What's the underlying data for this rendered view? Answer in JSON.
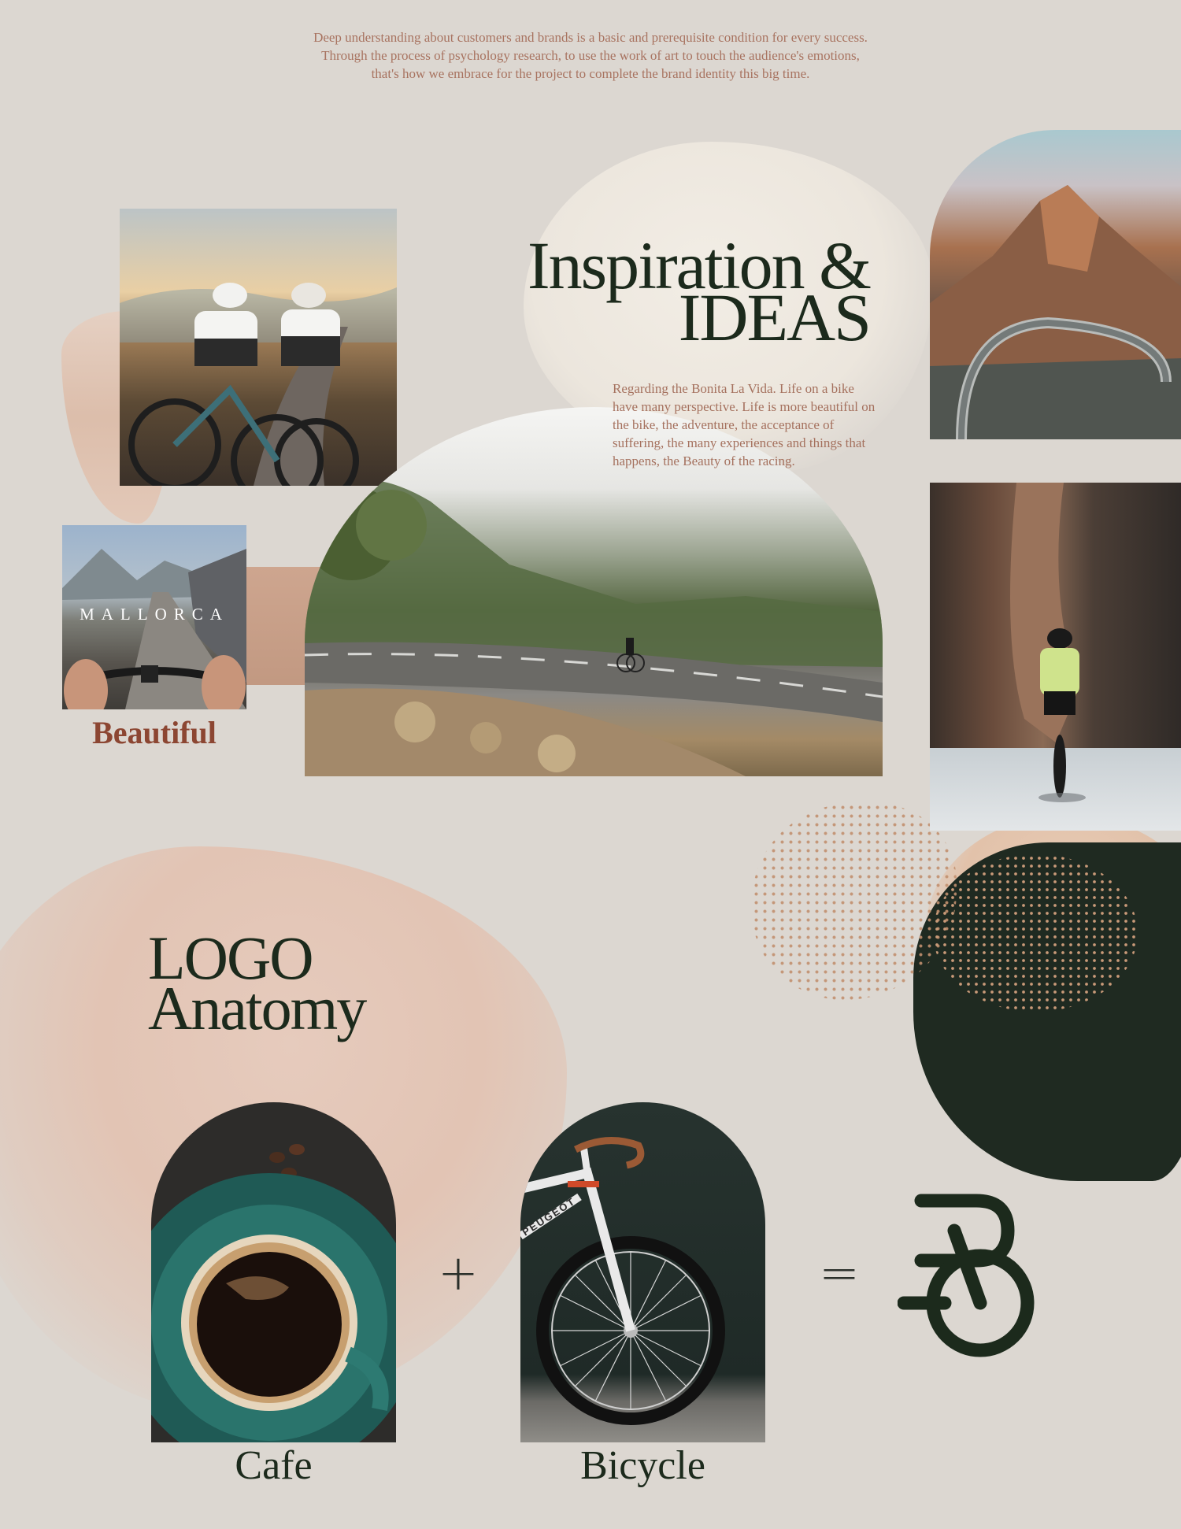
{
  "intro": {
    "line1": "Deep understanding about customers and brands is a basic and prerequisite condition for every success.",
    "line2": "Through the process of psychology research, to use the work of art to touch the audience's emotions,",
    "line3": "that's how we embrace for the project to complete the brand identity this big time."
  },
  "inspiration": {
    "title_line1": "Inspiration &",
    "title_line2": "IDEAS",
    "description": "Regarding the Bonita La Vida. Life on a bike have many perspective. Life is more beautiful on the bike, the adventure, the acceptance of suffering, the many experiences and things that happens, the Beauty of the racing."
  },
  "mallorca": {
    "photo_label": "MALLORCA",
    "caption": "Beautiful"
  },
  "logo_anatomy": {
    "title_line1": "LOGO",
    "title_line2": "Anatomy",
    "plus_symbol": "+",
    "equals_symbol": "=",
    "cafe_caption": "Cafe",
    "bicycle_caption": "Bicycle",
    "bicycle_frame_text": "PEUGEOT"
  },
  "colors": {
    "background": "#dcd7d1",
    "dark_green": "#1c2a1c",
    "terracotta_text": "#a5715e",
    "rust_caption": "#8c4632"
  }
}
